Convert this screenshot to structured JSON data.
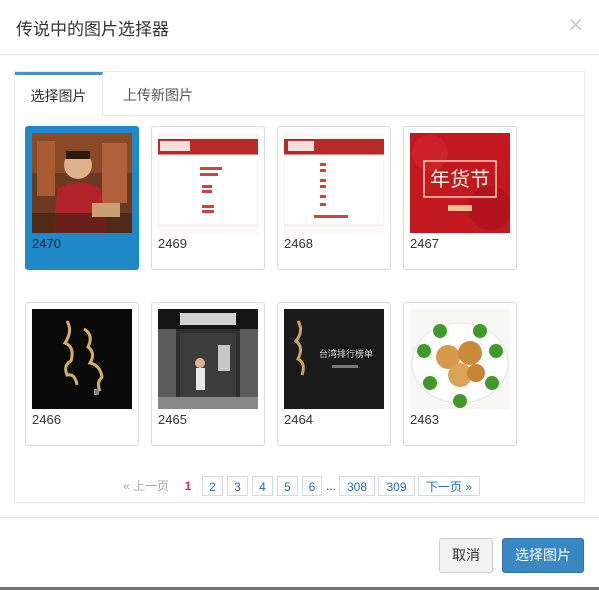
{
  "dialog": {
    "title": "传说中的图片选择器",
    "close_glyph": "×"
  },
  "tabs": [
    {
      "label": "选择图片",
      "active": true
    },
    {
      "label": "上传新图片",
      "active": false
    }
  ],
  "images": [
    {
      "id": "2470",
      "icon": "photo-man-in-red-jacket",
      "selected": true
    },
    {
      "id": "2469",
      "icon": "document-thumbnail",
      "selected": false
    },
    {
      "id": "2468",
      "icon": "document-thumbnail",
      "selected": false
    },
    {
      "id": "2467",
      "icon": "red-new-year-goods-poster",
      "overlay_text": "年货节",
      "selected": false
    },
    {
      "id": "2466",
      "icon": "black-calligraphy-poster",
      "selected": false
    },
    {
      "id": "2465",
      "icon": "shop-entrance-photo",
      "selected": false
    },
    {
      "id": "2464",
      "icon": "dark-ranking-poster",
      "overlay_text": "台湾排行榜单",
      "selected": false
    },
    {
      "id": "2463",
      "icon": "food-plate-photo",
      "selected": false
    }
  ],
  "pagination": {
    "prev": "« 上一页",
    "current": "1",
    "pages": [
      "2",
      "3",
      "4",
      "5",
      "6"
    ],
    "ellipsis": "...",
    "tail_pages": [
      "308",
      "309"
    ],
    "next": "下一页 »"
  },
  "footer": {
    "cancel_label": "取消",
    "confirm_label": "选择图片"
  },
  "colors": {
    "accent": "#3b87c2",
    "selected_tile": "#1d89c9",
    "current_page": "#e0245e"
  }
}
